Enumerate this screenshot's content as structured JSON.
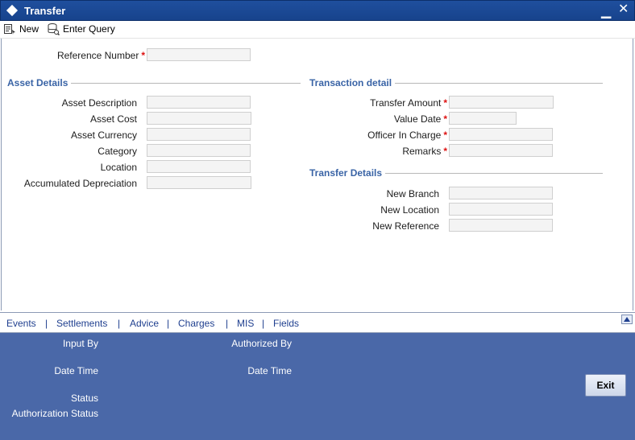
{
  "window": {
    "title": "Transfer"
  },
  "toolbar": {
    "new_label": "New",
    "enter_query_label": "Enter Query"
  },
  "main": {
    "reference_number": {
      "label": "Reference Number",
      "value": ""
    },
    "asset_details": {
      "title": "Asset Details",
      "fields": [
        {
          "label": "Asset Description",
          "value": ""
        },
        {
          "label": "Asset Cost",
          "value": ""
        },
        {
          "label": "Asset Currency",
          "value": ""
        },
        {
          "label": "Category",
          "value": ""
        },
        {
          "label": "Location",
          "value": ""
        },
        {
          "label": "Accumulated Depreciation",
          "value": ""
        }
      ]
    },
    "transaction_detail": {
      "title": "Transaction detail",
      "fields": [
        {
          "label": "Transfer Amount",
          "value": ""
        },
        {
          "label": "Value Date",
          "value": ""
        },
        {
          "label": "Officer In Charge",
          "value": ""
        },
        {
          "label": "Remarks",
          "value": ""
        }
      ]
    },
    "transfer_details": {
      "title": "Transfer Details",
      "fields": [
        {
          "label": "New Branch",
          "value": ""
        },
        {
          "label": "New Location",
          "value": ""
        },
        {
          "label": "New Reference",
          "value": ""
        }
      ]
    },
    "required_mark": "*"
  },
  "tabs": {
    "items": [
      "Events",
      "Settlements",
      "Advice",
      "Charges",
      "MIS",
      "Fields"
    ],
    "separator": "|"
  },
  "footer": {
    "input_by": "Input By",
    "authorized_by": "Authorized By",
    "date_time_left": "Date Time",
    "date_time_right": "Date Time",
    "status": "Status",
    "authorization_status": "Authorization Status",
    "exit_label": "Exit"
  },
  "icons": {
    "window": "diamond-icon",
    "minimize": "minimize-icon",
    "close": "close-icon",
    "new": "new-document-icon",
    "enter_query": "query-icon",
    "scroll_up": "scroll-up-icon"
  },
  "colors": {
    "title_bar": "#17438c",
    "section_title": "#3a64a6",
    "footer_bg": "#4a68a8",
    "required": "#dd1111",
    "tab_link": "#1f3f8f"
  }
}
